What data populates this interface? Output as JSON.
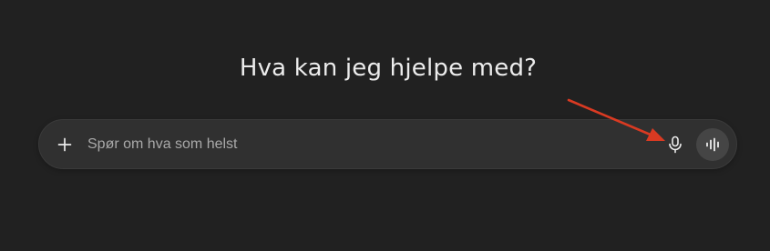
{
  "main": {
    "heading": "Hva kan jeg hjelpe med?"
  },
  "composer": {
    "placeholder": "Spør om hva som helst",
    "value": "",
    "left_icon": "plus-icon",
    "right_icons": [
      "microphone-icon",
      "voice-waveform-icon"
    ]
  },
  "annotation": {
    "icon": "red-arrow-pointing-to-microphone",
    "color": "#d93a22"
  },
  "colors": {
    "background": "#212121",
    "composer_bg": "#303030",
    "voice_button_bg": "#454545",
    "text": "#ececec",
    "placeholder": "#a9a9a9"
  }
}
